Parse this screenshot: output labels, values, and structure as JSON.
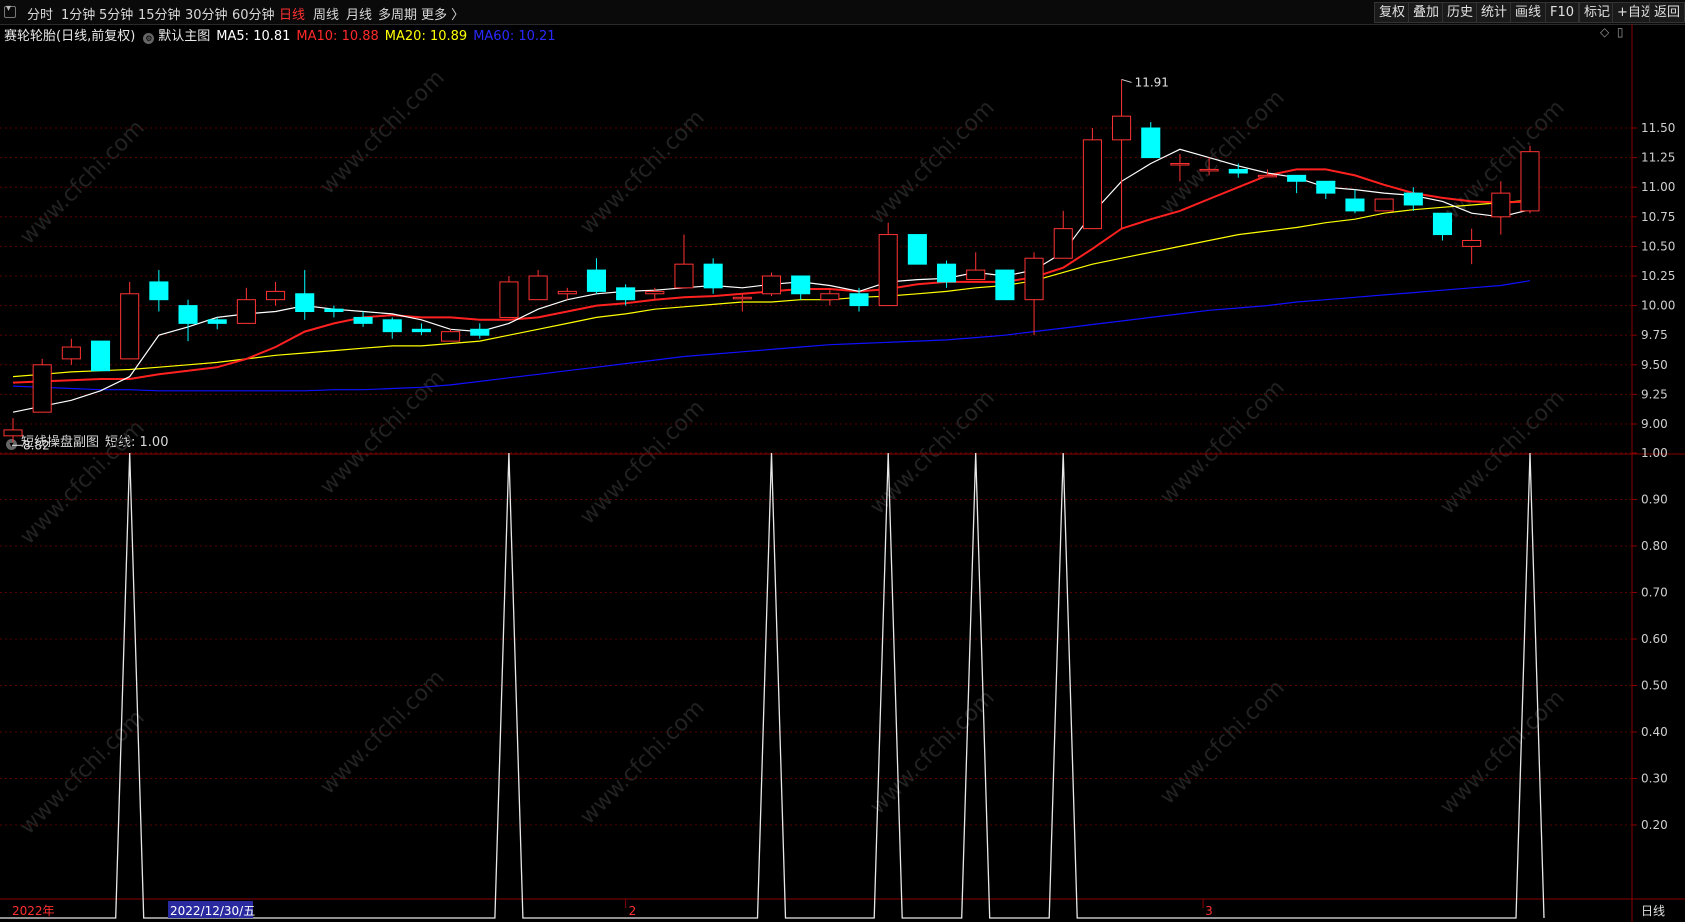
{
  "toolbar": {
    "periods": [
      "分时",
      "1分钟",
      "5分钟",
      "15分钟",
      "30分钟",
      "60分钟",
      "日线",
      "周线",
      "月线",
      "多周期",
      "更多 〉"
    ],
    "active_period": "日线",
    "right_buttons": [
      "复权",
      "叠加",
      "历史",
      "统计",
      "画线",
      "F10",
      "标记",
      "+自选",
      "返回"
    ]
  },
  "main_legend": {
    "stock": "赛轮轮胎(日线,前复权)",
    "template": "默认主图",
    "ma5": "MA5: 10.81",
    "ma10": "MA10: 10.88",
    "ma20": "MA20: 10.89",
    "ma60": "MA60: 10.21"
  },
  "sub_legend": {
    "title": "短线操盘副图",
    "value": "短线: 1.00"
  },
  "annotations": {
    "high": "11.91",
    "low": "8.82"
  },
  "time_axis": {
    "year": "2022年",
    "cursor_date": "2022/12/30/五",
    "m2": "2",
    "m3": "3",
    "period_label": "日线"
  },
  "watermark": "www.cfchi.com",
  "colors": {
    "up": "#ff3333",
    "down": "#00ffff",
    "ma5": "#ffffff",
    "ma10": "#ff2020",
    "ma20": "#ffff00",
    "ma60": "#1010ff",
    "grid": "#5a0000"
  },
  "chart_data": [
    {
      "type": "candlestick",
      "title": "",
      "ylim": [
        8.75,
        12.0
      ],
      "yticks": [
        "9.00",
        "9.25",
        "9.50",
        "9.75",
        "10.00",
        "10.25",
        "10.50",
        "10.75",
        "11.00",
        "11.25",
        "11.50"
      ],
      "ohlc": [
        [
          8.9,
          9.05,
          8.85,
          8.95
        ],
        [
          9.1,
          9.55,
          9.1,
          9.5
        ],
        [
          9.55,
          9.72,
          9.5,
          9.65
        ],
        [
          9.7,
          9.7,
          9.45,
          9.45
        ],
        [
          9.55,
          10.2,
          9.55,
          10.1
        ],
        [
          10.2,
          10.3,
          9.95,
          10.05
        ],
        [
          10.0,
          10.05,
          9.7,
          9.85
        ],
        [
          9.88,
          9.9,
          9.8,
          9.85
        ],
        [
          9.85,
          10.15,
          9.85,
          10.05
        ],
        [
          10.05,
          10.2,
          10.0,
          10.12
        ],
        [
          10.1,
          10.3,
          9.88,
          9.95
        ],
        [
          9.97,
          10.0,
          9.9,
          9.95
        ],
        [
          9.9,
          9.95,
          9.82,
          9.85
        ],
        [
          9.88,
          9.9,
          9.72,
          9.78
        ],
        [
          9.8,
          9.85,
          9.75,
          9.78
        ],
        [
          9.7,
          9.8,
          9.7,
          9.78
        ],
        [
          9.8,
          9.85,
          9.72,
          9.75
        ],
        [
          9.9,
          10.25,
          9.9,
          10.2
        ],
        [
          10.05,
          10.3,
          10.05,
          10.25
        ],
        [
          10.1,
          10.15,
          10.05,
          10.12
        ],
        [
          10.3,
          10.4,
          10.1,
          10.12
        ],
        [
          10.15,
          10.18,
          10.0,
          10.05
        ],
        [
          10.1,
          10.15,
          10.05,
          10.12
        ],
        [
          10.15,
          10.6,
          10.15,
          10.35
        ],
        [
          10.35,
          10.4,
          10.1,
          10.15
        ],
        [
          10.07,
          10.1,
          9.95,
          10.07
        ],
        [
          10.1,
          10.28,
          10.08,
          10.25
        ],
        [
          10.25,
          10.25,
          10.05,
          10.1
        ],
        [
          10.05,
          10.15,
          10.0,
          10.1
        ],
        [
          10.1,
          10.15,
          9.95,
          10.0
        ],
        [
          10.0,
          10.7,
          10.0,
          10.6
        ],
        [
          10.6,
          10.6,
          10.35,
          10.35
        ],
        [
          10.35,
          10.38,
          10.15,
          10.2
        ],
        [
          10.22,
          10.45,
          10.22,
          10.3
        ],
        [
          10.3,
          10.3,
          10.05,
          10.05
        ],
        [
          10.05,
          10.45,
          9.75,
          10.4
        ],
        [
          10.4,
          10.8,
          10.4,
          10.65
        ],
        [
          10.65,
          11.5,
          10.65,
          11.4
        ],
        [
          11.4,
          11.91,
          10.65,
          11.6
        ],
        [
          11.5,
          11.55,
          11.3,
          11.25
        ],
        [
          11.2,
          11.28,
          11.05,
          11.2
        ],
        [
          11.15,
          11.25,
          11.1,
          11.15
        ],
        [
          11.15,
          11.2,
          11.08,
          11.12
        ],
        [
          11.1,
          11.15,
          11.1,
          11.1
        ],
        [
          11.1,
          11.1,
          10.95,
          11.05
        ],
        [
          11.05,
          11.05,
          10.9,
          10.95
        ],
        [
          10.9,
          10.98,
          10.78,
          10.8
        ],
        [
          10.8,
          10.9,
          10.8,
          10.9
        ],
        [
          10.95,
          11.0,
          10.8,
          10.85
        ],
        [
          10.78,
          10.78,
          10.55,
          10.6
        ],
        [
          10.5,
          10.65,
          10.35,
          10.55
        ],
        [
          10.75,
          11.05,
          10.6,
          10.95
        ],
        [
          10.8,
          11.35,
          10.78,
          11.3
        ]
      ],
      "ma5": [
        9.1,
        9.15,
        9.2,
        9.28,
        9.4,
        9.75,
        9.82,
        9.9,
        9.93,
        9.95,
        10.0,
        9.97,
        9.95,
        9.93,
        9.88,
        9.8,
        9.78,
        9.85,
        9.97,
        10.05,
        10.1,
        10.12,
        10.13,
        10.15,
        10.17,
        10.15,
        10.18,
        10.2,
        10.17,
        10.12,
        10.2,
        10.22,
        10.23,
        10.28,
        10.25,
        10.3,
        10.45,
        10.78,
        11.05,
        11.2,
        11.32,
        11.25,
        11.18,
        11.12,
        11.08,
        11.0,
        10.98,
        10.95,
        10.93,
        10.88,
        10.78,
        10.75,
        10.81
      ],
      "ma10": [
        9.35,
        9.36,
        9.37,
        9.38,
        9.38,
        9.42,
        9.45,
        9.48,
        9.55,
        9.65,
        9.78,
        9.85,
        9.9,
        9.92,
        9.9,
        9.9,
        9.88,
        9.88,
        9.9,
        9.95,
        10.0,
        10.02,
        10.05,
        10.07,
        10.08,
        10.1,
        10.12,
        10.14,
        10.14,
        10.12,
        10.14,
        10.18,
        10.2,
        10.2,
        10.2,
        10.24,
        10.32,
        10.48,
        10.65,
        10.73,
        10.8,
        10.9,
        11.0,
        11.1,
        11.15,
        11.15,
        11.1,
        11.02,
        10.95,
        10.91,
        10.88,
        10.87,
        10.88
      ],
      "ma20": [
        9.4,
        9.42,
        9.44,
        9.45,
        9.46,
        9.48,
        9.5,
        9.52,
        9.55,
        9.58,
        9.6,
        9.62,
        9.64,
        9.66,
        9.66,
        9.68,
        9.7,
        9.75,
        9.8,
        9.85,
        9.9,
        9.93,
        9.97,
        9.99,
        10.01,
        10.03,
        10.03,
        10.05,
        10.05,
        10.07,
        10.08,
        10.1,
        10.12,
        10.15,
        10.17,
        10.21,
        10.28,
        10.35,
        10.4,
        10.45,
        10.5,
        10.55,
        10.6,
        10.63,
        10.66,
        10.7,
        10.73,
        10.78,
        10.81,
        10.83,
        10.85,
        10.87,
        10.89
      ],
      "ma60": [
        9.32,
        9.31,
        9.3,
        9.29,
        9.29,
        9.28,
        9.28,
        9.28,
        9.28,
        9.28,
        9.28,
        9.29,
        9.29,
        9.3,
        9.31,
        9.33,
        9.36,
        9.39,
        9.42,
        9.45,
        9.48,
        9.51,
        9.54,
        9.57,
        9.59,
        9.61,
        9.63,
        9.65,
        9.67,
        9.68,
        9.69,
        9.7,
        9.71,
        9.73,
        9.75,
        9.78,
        9.81,
        9.84,
        9.87,
        9.9,
        9.93,
        9.96,
        9.98,
        10.0,
        10.03,
        10.05,
        10.07,
        10.09,
        10.11,
        10.13,
        10.15,
        10.17,
        10.21
      ]
    },
    {
      "type": "line",
      "title": "",
      "ylim": [
        0.0,
        1.0
      ],
      "yticks": [
        "0.20",
        "0.30",
        "0.40",
        "0.50",
        "0.60",
        "0.70",
        "0.80",
        "0.90",
        "1.00"
      ],
      "series": [
        {
          "name": "短线",
          "values": [
            0,
            0,
            0,
            0,
            1,
            0,
            0,
            0,
            0,
            0,
            0,
            0,
            0,
            0,
            0,
            0,
            0,
            1,
            0,
            0,
            0,
            0,
            0,
            0,
            0,
            0,
            1,
            0,
            0,
            0,
            1,
            0,
            0,
            1,
            0,
            0,
            1,
            0,
            0,
            0,
            0,
            0,
            0,
            0,
            0,
            0,
            0,
            0,
            0,
            0,
            0,
            0,
            1
          ]
        }
      ]
    }
  ]
}
